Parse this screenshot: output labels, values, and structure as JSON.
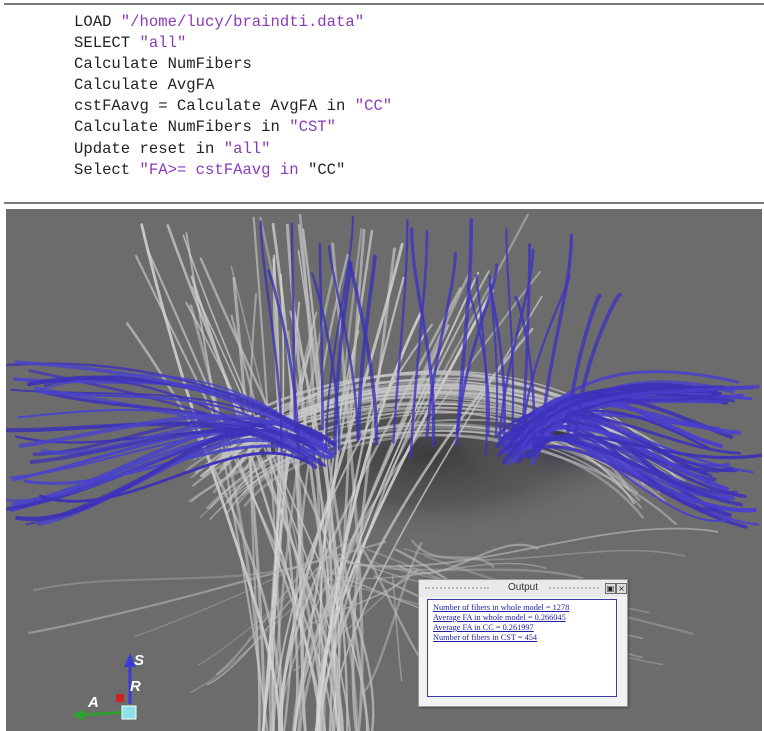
{
  "script": {
    "lines": [
      [
        "LOAD ",
        "\"/home/lucy/braindti.data\""
      ],
      [
        "SELECT ",
        "\"all\""
      ],
      [
        "Calculate NumFibers",
        ""
      ],
      [
        "Calculate AvgFA",
        ""
      ],
      [
        "cstFAavg = Calculate AvgFA in ",
        "\"CC\""
      ],
      [
        "Calculate NumFibers in ",
        "\"CST\""
      ],
      [
        "Update reset in ",
        "\"all\""
      ],
      [
        "Select ",
        "\"FA>= cstFAavg in ",
        "\"CC\""
      ]
    ]
  },
  "output_window": {
    "title": "Output",
    "float_icon": "float-icon",
    "close_icon": "close-icon",
    "lines": [
      "Number of fibers in whole model = 1278",
      "Average FA in whole model = 0.266045",
      "Average FA in CC = 0.261997",
      "Number of fibers in CST = 454"
    ]
  },
  "orientation_axes": {
    "superior": "S",
    "right": "R",
    "anterior": "A"
  },
  "colors": {
    "string_literal": "#8a3ab9",
    "selected_fibers": "#3d32b8",
    "unselected_fibers": "#cfcfcf",
    "background": "#6c6c6c",
    "output_text": "#2121a8"
  }
}
